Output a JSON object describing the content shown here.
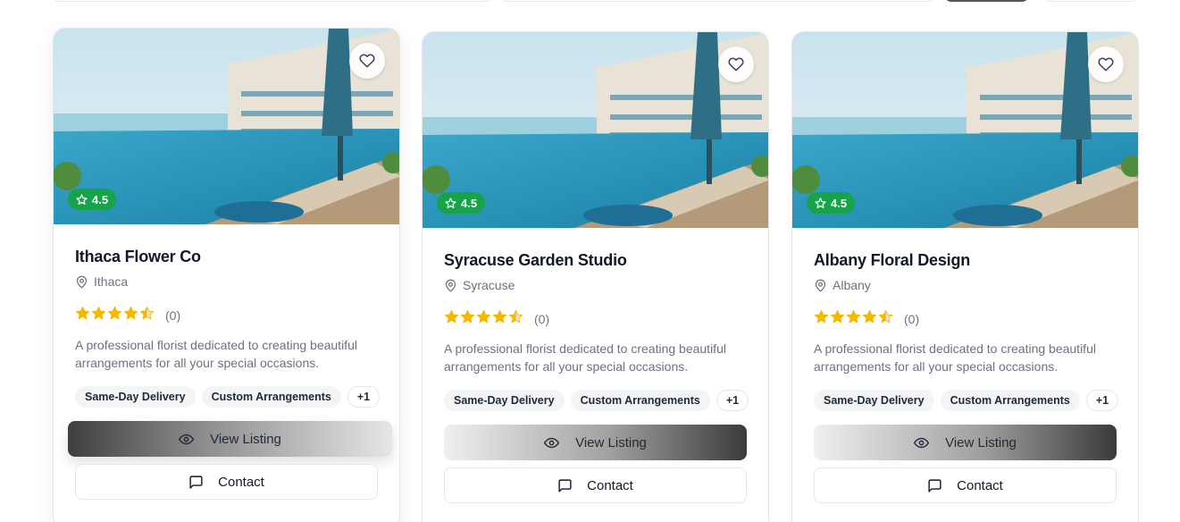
{
  "colors": {
    "rating_badge": "#16a34a",
    "star": "#f5b800",
    "border": "#e6e6e6",
    "muted_text": "#6b7280"
  },
  "icons": {
    "favorite": "heart-icon",
    "rating": "star-icon",
    "location": "map-pin-icon",
    "view": "eye-icon",
    "contact": "message-square-icon"
  },
  "listings": [
    {
      "badge_rating": "4.5",
      "name": "Ithaca Flower Co",
      "location": "Ithaca",
      "stars": 4.5,
      "review_count": "(0)",
      "description": "A professional florist dedicated to creating beautiful arrangements for all your special occasions.",
      "tags": [
        "Same-Day Delivery",
        "Custom Arrangements"
      ],
      "more_tags": "+1",
      "view_label": "View Listing",
      "contact_label": "Contact"
    },
    {
      "badge_rating": "4.5",
      "name": "Syracuse Garden Studio",
      "location": "Syracuse",
      "stars": 4.5,
      "review_count": "(0)",
      "description": "A professional florist dedicated to creating beautiful arrangements for all your special occasions.",
      "tags": [
        "Same-Day Delivery",
        "Custom Arrangements"
      ],
      "more_tags": "+1",
      "view_label": "View Listing",
      "contact_label": "Contact"
    },
    {
      "badge_rating": "4.5",
      "name": "Albany Floral Design",
      "location": "Albany",
      "stars": 4.5,
      "review_count": "(0)",
      "description": "A professional florist dedicated to creating beautiful arrangements for all your special occasions.",
      "tags": [
        "Same-Day Delivery",
        "Custom Arrangements"
      ],
      "more_tags": "+1",
      "view_label": "View Listing",
      "contact_label": "Contact"
    }
  ]
}
